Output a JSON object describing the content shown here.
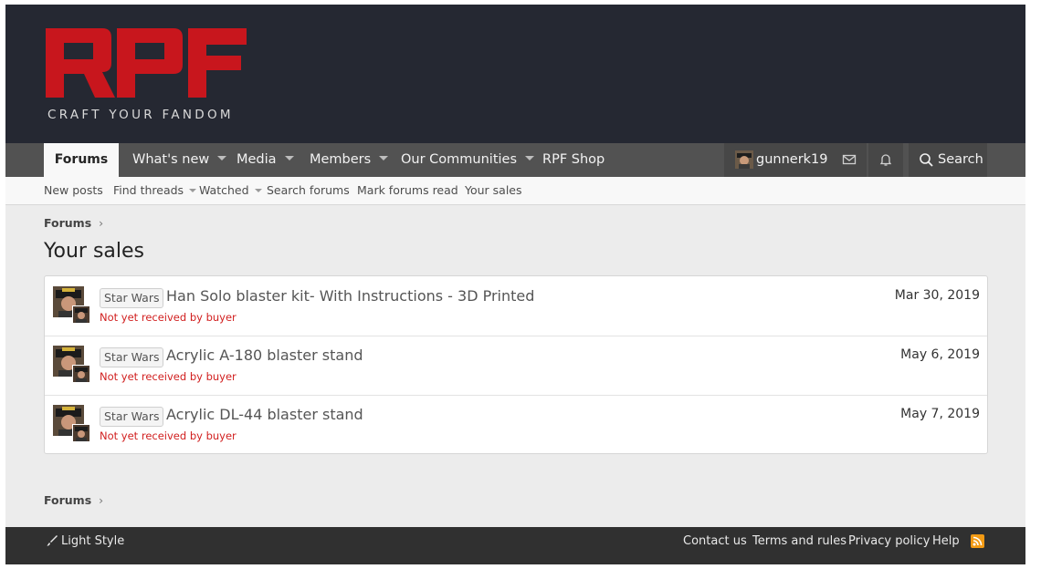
{
  "brand": {
    "logo_text": "RPF",
    "tagline": "CRAFT YOUR FANDOM",
    "logo_color": "#c8161d"
  },
  "nav": {
    "items": [
      {
        "label": "Forums",
        "active": true
      },
      {
        "label": "What's new",
        "dropdown": true
      },
      {
        "label": "Media",
        "dropdown": true
      },
      {
        "label": "Members",
        "dropdown": true
      },
      {
        "label": "Our Communities",
        "dropdown": true
      },
      {
        "label": "RPF Shop"
      }
    ],
    "username": "gunnerk19",
    "search_label": "Search"
  },
  "subnav": {
    "items": [
      {
        "label": "New posts"
      },
      {
        "label": "Find threads",
        "dropdown": true
      },
      {
        "label": "Watched",
        "dropdown": true
      },
      {
        "label": "Search forums"
      },
      {
        "label": "Mark forums read"
      },
      {
        "label": "Your sales"
      }
    ]
  },
  "breadcrumb": {
    "label": "Forums",
    "separator": "›"
  },
  "page_title": "Your sales",
  "sales": [
    {
      "prefix": "Star Wars",
      "title": "Han Solo blaster kit- With Instructions - 3D Printed",
      "status": "Not yet received by buyer",
      "date": "Mar 30, 2019"
    },
    {
      "prefix": "Star Wars",
      "title": "Acrylic A-180 blaster stand",
      "status": "Not yet received by buyer",
      "date": "May 6, 2019"
    },
    {
      "prefix": "Star Wars",
      "title": "Acrylic DL-44 blaster stand",
      "status": "Not yet received by buyer",
      "date": "May 7, 2019"
    }
  ],
  "footer": {
    "style_label": "Light Style",
    "links": [
      {
        "label": "Contact us"
      },
      {
        "label": "Terms and rules"
      },
      {
        "label": "Privacy policy"
      },
      {
        "label": "Help"
      }
    ],
    "rss_icon": "rss-icon"
  },
  "colors": {
    "header_bg": "#252832",
    "nav_bg": "#525252",
    "status_red": "#d11f1f",
    "rss_orange": "#f29a14"
  }
}
